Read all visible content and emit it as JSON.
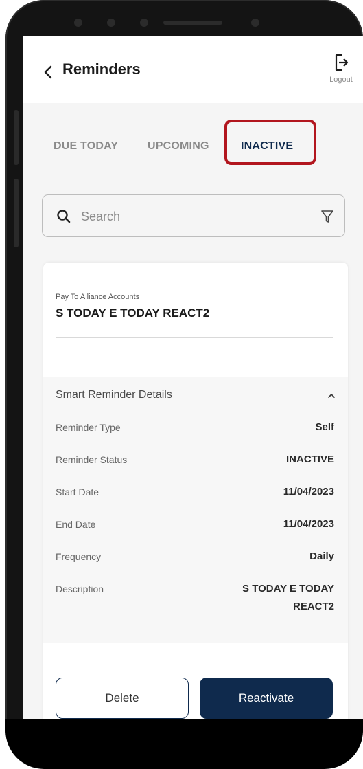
{
  "header": {
    "title": "Reminders",
    "logout_label": "Logout"
  },
  "tabs": [
    {
      "label": "DUE TODAY",
      "active": false
    },
    {
      "label": "UPCOMING",
      "active": false
    },
    {
      "label": "INACTIVE",
      "active": true
    }
  ],
  "search": {
    "placeholder": "Search"
  },
  "reminder": {
    "category_label": "Pay To Alliance Accounts",
    "name": "S TODAY E TODAY REACT2",
    "details_title": "Smart Reminder Details",
    "rows": [
      {
        "label": "Reminder Type",
        "value": "Self"
      },
      {
        "label": "Reminder Status",
        "value": "INACTIVE"
      },
      {
        "label": "Start Date",
        "value": "11/04/2023"
      },
      {
        "label": "End Date",
        "value": "11/04/2023"
      },
      {
        "label": "Frequency",
        "value": "Daily"
      },
      {
        "label": "Description",
        "value_line1": "S TODAY E TODAY",
        "value_line2": "REACT2"
      }
    ]
  },
  "actions": {
    "delete_label": "Delete",
    "reactivate_label": "Reactivate"
  },
  "colors": {
    "primary": "#0f2a4d",
    "highlight": "#b2161e"
  }
}
